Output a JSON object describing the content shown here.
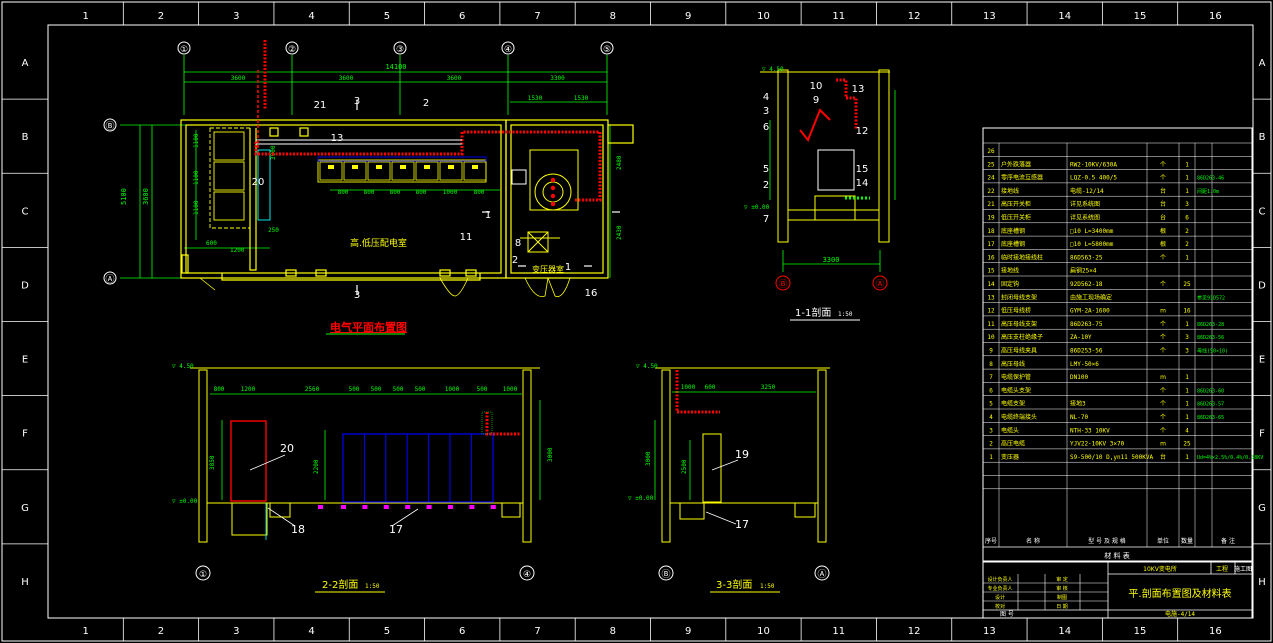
{
  "frame": {
    "columns": [
      "1",
      "2",
      "3",
      "4",
      "5",
      "6",
      "7",
      "8",
      "9",
      "10",
      "11",
      "12",
      "13",
      "14",
      "15",
      "16"
    ],
    "rows": [
      "A",
      "B",
      "C",
      "D",
      "E",
      "F",
      "G",
      "H"
    ]
  },
  "plan": {
    "axes": [
      "①",
      "②",
      "③",
      "④",
      "⑤",
      "Ⓑ",
      "Ⓐ"
    ],
    "dims_top": [
      "3600",
      "3600",
      "3600",
      "3300"
    ],
    "dim_total": "14100",
    "dims_right_top": [
      "1530",
      "1530"
    ],
    "dims_busbar": [
      "800",
      "800",
      "800",
      "800",
      "1000",
      "800"
    ],
    "dims_side": [
      "5100",
      "3600"
    ],
    "dims_misc": [
      "600",
      "1200",
      "1100",
      "1100",
      "1100",
      "3900",
      "2480",
      "2430",
      "250"
    ],
    "room_label": "高.低压配电室",
    "trans_label": "变压器室",
    "title": "电气平面布置图",
    "labels": [
      "21",
      "2",
      "13",
      "20",
      "11",
      "8",
      "1",
      "16",
      "1",
      "2",
      "3",
      "3"
    ]
  },
  "sec11": {
    "title": "1-1剖面",
    "scale": "1:50",
    "elev": "▽ 4.50",
    "zero": "▽ ±0.00",
    "dim": "3300",
    "axes": [
      "Ⓑ",
      "Ⓐ"
    ],
    "labels": [
      "4",
      "3",
      "6",
      "5",
      "2",
      "7",
      "10",
      "9",
      "13",
      "12",
      "15",
      "14"
    ]
  },
  "sec22": {
    "title": "2-2剖面",
    "scale": "1:50",
    "elev": "▽ 4.50",
    "zero": "▽ ±0.00",
    "dims": [
      "800",
      "1200",
      "2560",
      "500",
      "500",
      "500",
      "500",
      "1000",
      "500",
      "1000"
    ],
    "vdims": [
      "3850",
      "2200",
      "3000"
    ],
    "labels": [
      "20",
      "18",
      "17"
    ],
    "axes": [
      "①",
      "④"
    ]
  },
  "sec33": {
    "title": "3-3剖面",
    "scale": "1:50",
    "elev": "▽ 4.50",
    "zero": "▽ ±0.00",
    "dims": [
      "1000",
      "600",
      "3250"
    ],
    "vdims": [
      "3000",
      "2500"
    ],
    "labels": [
      "19",
      "17"
    ],
    "axes": [
      "Ⓑ",
      "Ⓐ"
    ]
  },
  "bom": {
    "caption": "材 料 表",
    "header": [
      "序号",
      "名 称",
      "型 号 及 规 格",
      "单位",
      "数量",
      "备 注"
    ],
    "rows": [
      [
        "26",
        "",
        "",
        "",
        "",
        ""
      ],
      [
        "25",
        "户外跌落器",
        "RW2-10KV/630A",
        "个",
        "1",
        ""
      ],
      [
        "24",
        "零序电流互感器",
        "LQZ-0.5 400/5",
        "个",
        "1",
        "86D263-46"
      ],
      [
        "22",
        "接地线",
        "电缆-12/14",
        "台",
        "1",
        "间距1.0m"
      ],
      [
        "21",
        "高压开关柜",
        "详见系统图",
        "台",
        "3",
        ""
      ],
      [
        "19",
        "低压开关柜",
        "详见系统图",
        "台",
        "6",
        ""
      ],
      [
        "18",
        "底座槽钢",
        "□10 L=3400mm",
        "根",
        "2",
        ""
      ],
      [
        "17",
        "底座槽钢",
        "□10 L=5800mm",
        "根",
        "2",
        ""
      ],
      [
        "16",
        "临时接地接线柱",
        "86D563-25",
        "个",
        "1",
        ""
      ],
      [
        "15",
        "接地线",
        "扁钢25×4",
        "",
        "",
        ""
      ],
      [
        "14",
        "固定钩",
        "92D562-18",
        "个",
        "25",
        ""
      ],
      [
        "13",
        "封闭母线支架",
        "由施工现场确定",
        "",
        "",
        "参见91D572"
      ],
      [
        "12",
        "低压母线桥",
        "GYM-2A-1600",
        "m",
        "16",
        ""
      ],
      [
        "11",
        "高压母线支架",
        "86D263-75",
        "个",
        "1",
        "86D263-28"
      ],
      [
        "10",
        "高压支柱绝缘子",
        "ZA-10Y",
        "个",
        "3",
        "86D263-56"
      ],
      [
        "9",
        "高压母线夹具",
        "86D253-56",
        "个",
        "3",
        "母线(50×10)"
      ],
      [
        "8",
        "高压母线",
        "LMY-50×6",
        "",
        "",
        "",
        ""
      ],
      [
        "7",
        "电缆保护管",
        "DN100",
        "m",
        "1",
        ""
      ],
      [
        "6",
        "电缆头支架",
        "",
        "个",
        "1",
        "86D263-60"
      ],
      [
        "5",
        "电缆支架",
        "接地3",
        "个",
        "1",
        "86D263-57"
      ],
      [
        "4",
        "电缆终端接头",
        "NL-70",
        "个",
        "1",
        "86D263-65"
      ],
      [
        "3",
        "电缆头",
        "NTH-33 10KV",
        "个",
        "4",
        ""
      ],
      [
        "2",
        "高压电缆",
        "YJV22-10KV 3×70",
        "m",
        "25",
        ""
      ],
      [
        "1",
        "变压器",
        "S9-500/10 D,yn11 500KVA",
        "台",
        "1",
        "Ud=4%×2.5%/0.4%/0.38KV"
      ]
    ]
  },
  "titleblock": {
    "project": "10KV变电所",
    "phase": "工程",
    "stage": "施工图",
    "drawing_title": "平.剖面布置图及材料表",
    "left_cells": [
      "设计负责人",
      "专业负责人",
      "审 定",
      "审 核",
      "设计",
      "校对",
      "制图",
      "日 期"
    ],
    "code": "电施-4/14",
    "number_label": "图 号"
  }
}
